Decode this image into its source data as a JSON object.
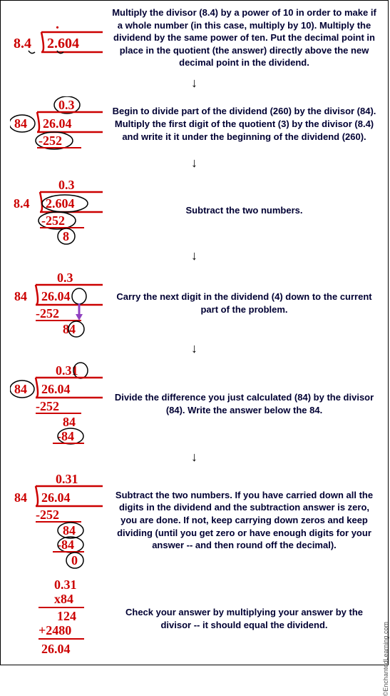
{
  "steps": [
    {
      "divisor": "8.4",
      "dividend": "2.604",
      "text": "Multiply the divisor (8.4) by a power of 10 in order to make if a whole number (in this case, multiply by 10). Multiply the dividend by the same power of ten. Put the decimal point in place in the quotient (the answer) directly above the new decimal point in the dividend."
    },
    {
      "quotient": "0.3",
      "divisor": "84",
      "dividend": "26.04",
      "sub": "-252",
      "text": "Begin to divide part of the dividend (260) by the divisor (84). Multiply the first digit of the quotient (3) by the divisor (8.4) and write it it under the beginning of the dividend (260)."
    },
    {
      "quotient": "0.3",
      "divisor": "8.4",
      "dividend": "2.604",
      "sub": "-252",
      "remainder": "8",
      "text": "Subtract the two numbers."
    },
    {
      "quotient": "0.3",
      "divisor": "84",
      "dividend": "26.04",
      "sub": "-252",
      "carry": "84",
      "text": "Carry the next digit in the dividend (4) down to the current part of the problem."
    },
    {
      "quotient": "0.31",
      "divisor": "84",
      "dividend": "26.04",
      "sub1": "-252",
      "rem1": "84",
      "sub2": "-84",
      "text": "Divide the difference you just calculated (84) by the divisor (84).  Write the answer below the 84."
    },
    {
      "quotient": "0.31",
      "divisor": "84",
      "dividend": "26.04",
      "sub1": "-252",
      "rem1": "84",
      "sub2": "-84",
      "rem2": "0",
      "text": "Subtract the two numbers. If you have carried down all the digits in the dividend and the subtraction answer is zero, you are done. If not, keep carrying down zeros and keep dividing (until you get zero or have enough digits for your answer -- and then round off the decimal)."
    },
    {
      "check_quotient": "0.31",
      "check_mult": "x84",
      "check_p1": "124",
      "check_p2": "+2480",
      "check_result": "26.04",
      "text": "Check your answer by multiplying your answer by the divisor -- it should equal the dividend."
    }
  ],
  "credit": "©EnchantedLearning.com"
}
